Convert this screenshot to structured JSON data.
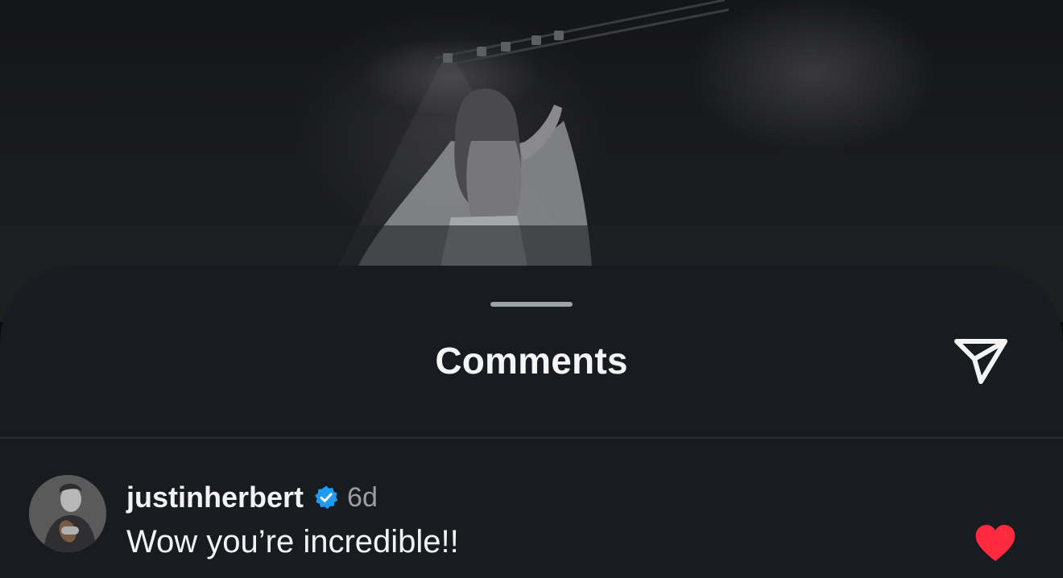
{
  "sheet": {
    "title": "Comments",
    "share_icon": "paper-plane-icon"
  },
  "comments": [
    {
      "username": "justinherbert",
      "verified": true,
      "time": "6d",
      "text": "Wow you’re incredible!!",
      "liked": true
    }
  ],
  "colors": {
    "sheet_background": "#181b20",
    "text_primary": "#f3f3f3",
    "text_secondary": "#9a9fa7",
    "verified_blue": "#1d9bf0",
    "like_red": "#ff2a3d",
    "divider": "#2b2f35",
    "grabber": "#9ea2a9"
  }
}
